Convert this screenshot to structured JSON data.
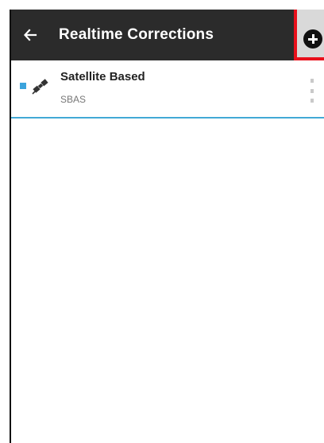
{
  "toolbar": {
    "title": "Realtime Corrections",
    "back_icon": "arrow-left-icon",
    "add_icon": "add-circle-icon"
  },
  "corrections": [
    {
      "name": "Satellite Based",
      "type": "SBAS",
      "icon": "satellite-icon",
      "status_color": "#3ba3dc"
    }
  ],
  "colors": {
    "toolbar_bg": "#2b2b2b",
    "highlight": "#e8101b",
    "accent": "#42a9d6"
  }
}
